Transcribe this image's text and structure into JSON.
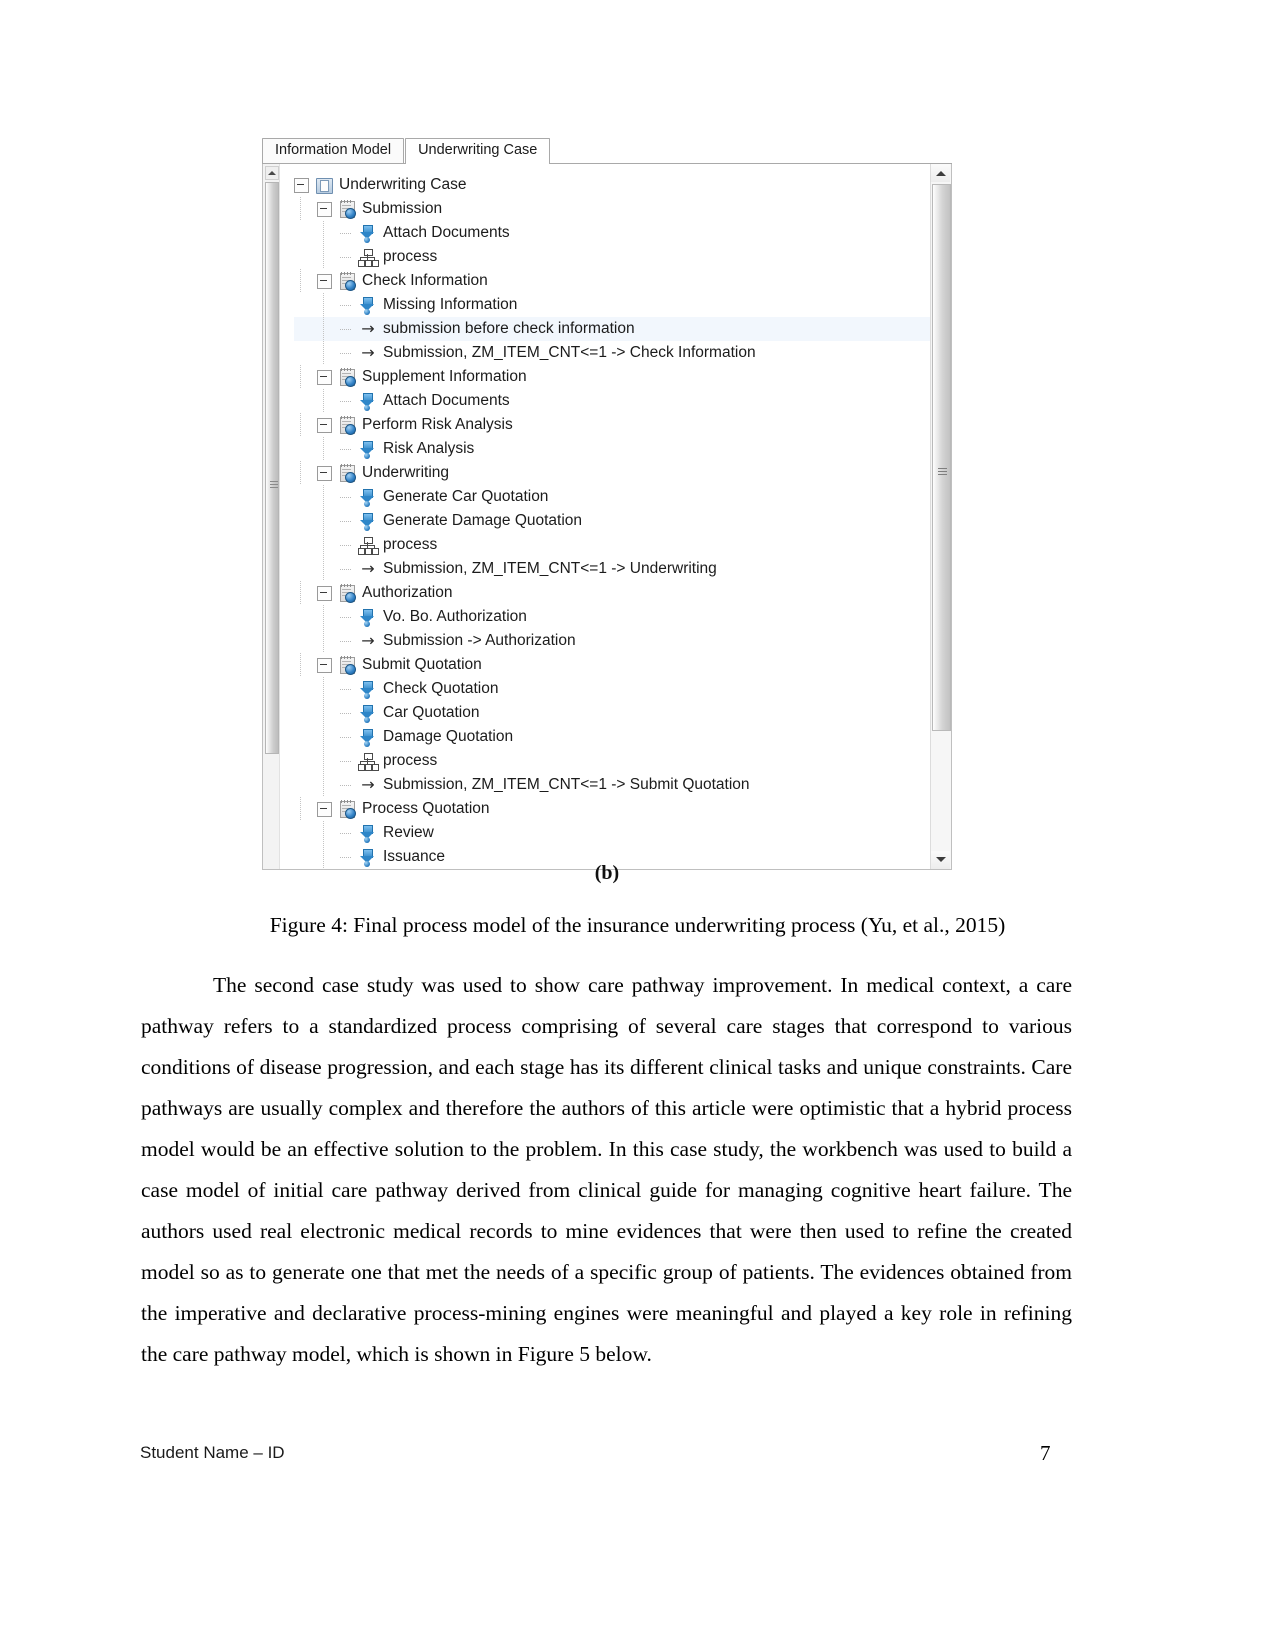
{
  "document": {
    "figure_caption": "Figure 4: Final process model of the insurance underwriting process (Yu, et al., 2015)",
    "subfigure_label": "(b)",
    "body_paragraph": "The second case study was used to show care pathway improvement. In medical context, a care pathway refers to a standardized process comprising of several care stages that correspond to various conditions of disease progression, and each stage has its different clinical tasks and unique constraints. Care pathways are usually complex and therefore the authors of this article were optimistic that a hybrid process model would be an effective solution to the problem. In this case study, the workbench was used to build a case model of initial care pathway derived from clinical guide for managing cognitive heart failure. The authors used real electronic medical records to mine evidences that were then used to refine the created model so as to generate one that met the needs of a specific group of patients. The evidences obtained from the imperative and declarative process-mining engines were meaningful and played a key role in refining the care pathway model, which is shown in Figure 5 below.",
    "footer_left": "Student Name – ID",
    "page_number": "7"
  },
  "figure": {
    "tabs": [
      {
        "label": "Information Model",
        "active": false
      },
      {
        "label": "Underwriting Case",
        "active": true
      }
    ],
    "tree": [
      {
        "label": "Underwriting Case",
        "level": 0,
        "icon": "case-icon",
        "expander": true,
        "selected": false
      },
      {
        "label": "Submission",
        "level": 1,
        "icon": "stage-icon",
        "expander": true,
        "selected": false
      },
      {
        "label": "Attach Documents",
        "level": 2,
        "icon": "task-icon",
        "expander": false,
        "selected": false
      },
      {
        "label": "process",
        "level": 2,
        "icon": "process-icon",
        "expander": false,
        "selected": false
      },
      {
        "label": "Check Information",
        "level": 1,
        "icon": "stage-icon",
        "expander": true,
        "selected": false
      },
      {
        "label": "Missing Information",
        "level": 2,
        "icon": "task-icon",
        "expander": false,
        "selected": false
      },
      {
        "label": "submission before check information",
        "level": 2,
        "icon": "relation-icon",
        "expander": false,
        "selected": true
      },
      {
        "label": "Submission, ZM_ITEM_CNT<=1 -> Check Information",
        "level": 2,
        "icon": "relation-icon",
        "expander": false,
        "selected": false
      },
      {
        "label": "Supplement Information",
        "level": 1,
        "icon": "stage-icon",
        "expander": true,
        "selected": false
      },
      {
        "label": "Attach Documents",
        "level": 2,
        "icon": "task-icon",
        "expander": false,
        "selected": false
      },
      {
        "label": "Perform Risk Analysis",
        "level": 1,
        "icon": "stage-icon",
        "expander": true,
        "selected": false
      },
      {
        "label": "Risk Analysis",
        "level": 2,
        "icon": "task-icon",
        "expander": false,
        "selected": false
      },
      {
        "label": "Underwriting",
        "level": 1,
        "icon": "stage-icon",
        "expander": true,
        "selected": false
      },
      {
        "label": "Generate Car Quotation",
        "level": 2,
        "icon": "task-icon",
        "expander": false,
        "selected": false
      },
      {
        "label": "Generate Damage Quotation",
        "level": 2,
        "icon": "task-icon",
        "expander": false,
        "selected": false
      },
      {
        "label": "process",
        "level": 2,
        "icon": "process-icon",
        "expander": false,
        "selected": false
      },
      {
        "label": "Submission, ZM_ITEM_CNT<=1 -> Underwriting",
        "level": 2,
        "icon": "relation-icon",
        "expander": false,
        "selected": false
      },
      {
        "label": "Authorization",
        "level": 1,
        "icon": "stage-icon",
        "expander": true,
        "selected": false
      },
      {
        "label": "Vo. Bo. Authorization",
        "level": 2,
        "icon": "task-icon",
        "expander": false,
        "selected": false
      },
      {
        "label": "Submission -> Authorization",
        "level": 2,
        "icon": "relation-icon",
        "expander": false,
        "selected": false
      },
      {
        "label": "Submit Quotation",
        "level": 1,
        "icon": "stage-icon",
        "expander": true,
        "selected": false
      },
      {
        "label": "Check Quotation",
        "level": 2,
        "icon": "task-icon",
        "expander": false,
        "selected": false
      },
      {
        "label": "Car Quotation",
        "level": 2,
        "icon": "task-icon",
        "expander": false,
        "selected": false
      },
      {
        "label": "Damage Quotation",
        "level": 2,
        "icon": "task-icon",
        "expander": false,
        "selected": false
      },
      {
        "label": "process",
        "level": 2,
        "icon": "process-icon",
        "expander": false,
        "selected": false
      },
      {
        "label": "Submission, ZM_ITEM_CNT<=1 -> Submit Quotation",
        "level": 2,
        "icon": "relation-icon",
        "expander": false,
        "selected": false
      },
      {
        "label": "Process Quotation",
        "level": 1,
        "icon": "stage-icon",
        "expander": true,
        "selected": false
      },
      {
        "label": "Review",
        "level": 2,
        "icon": "task-icon",
        "expander": false,
        "selected": false
      },
      {
        "label": "Issuance",
        "level": 2,
        "icon": "task-icon",
        "expander": false,
        "selected": false
      }
    ],
    "scrollbar": {
      "up_arrow": "scroll-up-icon",
      "down_arrow": "scroll-down-icon"
    },
    "colors": {
      "selection": "#f2f7fd",
      "icon_blue": "#2e86c8",
      "text": "#1c1c1c"
    }
  }
}
